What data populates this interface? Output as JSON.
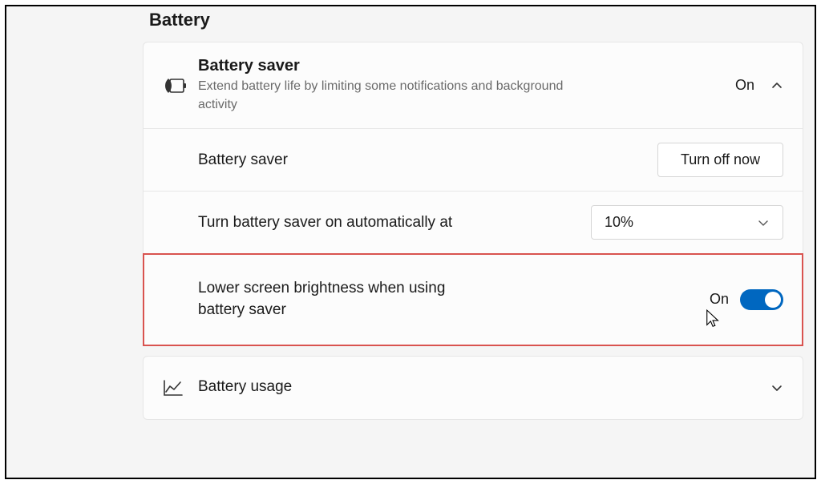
{
  "section": {
    "title": "Battery"
  },
  "batterySaver": {
    "title": "Battery saver",
    "description": "Extend battery life by limiting some notifications and background activity",
    "status": "On",
    "rows": {
      "saverControl": {
        "label": "Battery saver",
        "button": "Turn off now"
      },
      "autoThreshold": {
        "label": "Turn battery saver on automatically at",
        "value": "10%"
      },
      "lowerBrightness": {
        "label": "Lower screen brightness when using battery saver",
        "toggleLabel": "On"
      }
    }
  },
  "batteryUsage": {
    "title": "Battery usage"
  }
}
